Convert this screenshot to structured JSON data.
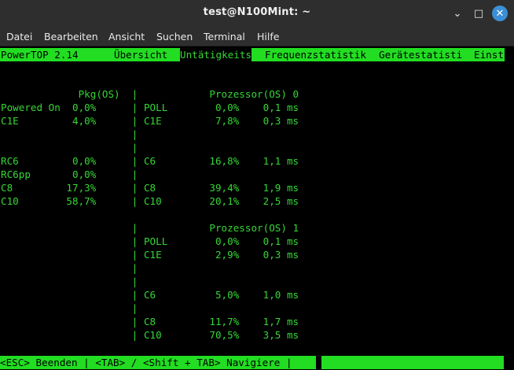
{
  "window": {
    "title": "test@N100Mint: ~",
    "buttons": {
      "minimize": "⌄",
      "maximize": "□",
      "close": "✕"
    }
  },
  "menu": [
    "Datei",
    "Bearbeiten",
    "Ansicht",
    "Suchen",
    "Terminal",
    "Hilfe"
  ],
  "tabs": {
    "version": "PowerTOP 2.14",
    "items": [
      "Übersicht",
      "Untätigkeits",
      "Frequenzstatistik",
      "Gerätestatisti",
      "Einst"
    ],
    "active_index": 1
  },
  "terminal_lines": [
    "",
    "",
    "",
    "             Pkg(OS)  |            Prozessor(OS) 0",
    "Powered On  0,0%      | POLL        0,0%    0,1 ms",
    "C1E         4,0%      | C1E         7,8%    0,3 ms",
    "                      |",
    "                      |",
    "RC6         0,0%      | C6         16,8%    1,1 ms",
    "RC6pp       0,0%      |",
    "C8         17,3%      | C8         39,4%    1,9 ms",
    "C10        58,7%      | C10        20,1%    2,5 ms",
    "",
    "                      |            Prozessor(OS) 1",
    "                      | POLL        0,0%    0,1 ms",
    "                      | C1E         2,9%    0,3 ms",
    "                      |",
    "                      |",
    "                      | C6          5,0%    1,0 ms",
    "                      |",
    "                      | C8         11,7%    1,7 ms",
    "                      | C10        70,5%    3,5 ms"
  ],
  "status_bar": "<ESC> Beenden | <TAB> / <Shift + TAB> Navigiere |",
  "colors": {
    "terminal_fg": "#36d636",
    "highlight_bg": "#22dd22",
    "terminal_bg": "#000000",
    "titlebar_bg": "#2e2e2e",
    "close_button": "#3b8fd6"
  }
}
